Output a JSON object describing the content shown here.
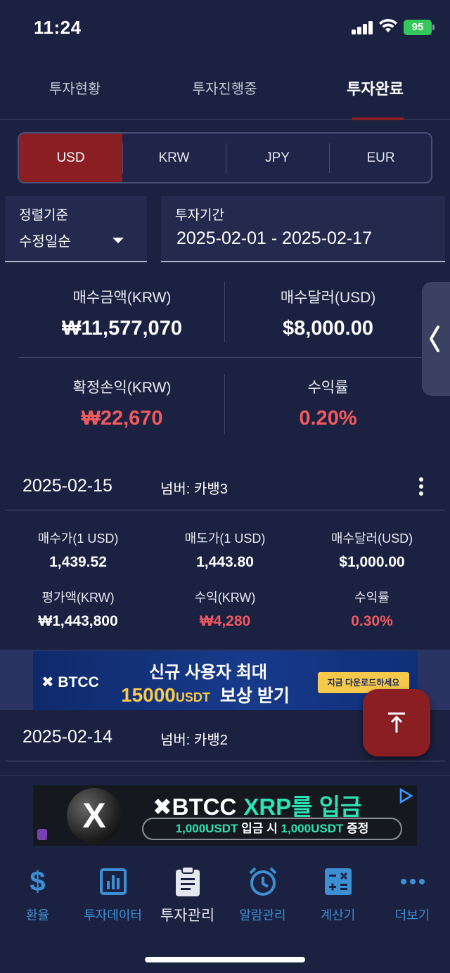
{
  "status": {
    "time": "11:24",
    "battery": "95"
  },
  "tabs": [
    {
      "label": "투자현황"
    },
    {
      "label": "투자진행중"
    },
    {
      "label": "투자완료"
    }
  ],
  "currencies": [
    "USD",
    "KRW",
    "JPY",
    "EUR"
  ],
  "selected_currency": "USD",
  "sort": {
    "label": "정렬기준",
    "value": "수정일순"
  },
  "period": {
    "label": "투자기간",
    "value": "2025-02-01 - 2025-02-17"
  },
  "summary": {
    "buy_amount_label": "매수금액(KRW)",
    "buy_amount": "₩11,577,070",
    "buy_usd_label": "매수달러(USD)",
    "buy_usd": "$8,000.00",
    "realized_label": "확정손익(KRW)",
    "realized": "₩22,670",
    "rate_label": "수익률",
    "rate": "0.20%"
  },
  "records": [
    {
      "date": "2025-02-15",
      "number": "넘버: 카뱅3",
      "buy_price_label": "매수가(1 USD)",
      "buy_price": "1,439.52",
      "sell_price_label": "매도가(1 USD)",
      "sell_price": "1,443.80",
      "buy_usd_label": "매수달러(USD)",
      "buy_usd": "$1,000.00",
      "valuation_label": "평가액(KRW)",
      "valuation": "₩1,443,800",
      "profit_label": "수익(KRW)",
      "profit": "₩4,280",
      "rate_label": "수익률",
      "rate": "0.30%"
    },
    {
      "date": "2025-02-14",
      "number": "넘버: 카뱅2"
    }
  ],
  "ads": {
    "ad1": {
      "logo": "✖ BTCC",
      "line1": "신규 사용자 최대",
      "amount": "15000",
      "unit": "USDT",
      "line2_tail": "보상 받기",
      "cta": "지금 다운로드하세요"
    },
    "ad2": {
      "brand": "✖BTCC",
      "highlight": "XRP를 입금",
      "pill_a": "1,000USDT",
      "pill_b": " 입금 시 ",
      "pill_c": "1,000USDT",
      "pill_d": " 증정"
    }
  },
  "nav": [
    {
      "label": "환율",
      "icon": "dollar-icon"
    },
    {
      "label": "투자데이터",
      "icon": "chart-icon"
    },
    {
      "label": "투자관리",
      "icon": "clipboard-icon"
    },
    {
      "label": "알람관리",
      "icon": "alarm-icon"
    },
    {
      "label": "계산기",
      "icon": "calculator-icon"
    },
    {
      "label": "더보기",
      "icon": "more-icon"
    }
  ],
  "active_nav": "투자관리",
  "colors": {
    "background": "#1b2140",
    "accent": "#8b1e23",
    "profit": "#f25a60",
    "nav": "#3d8fd4"
  }
}
